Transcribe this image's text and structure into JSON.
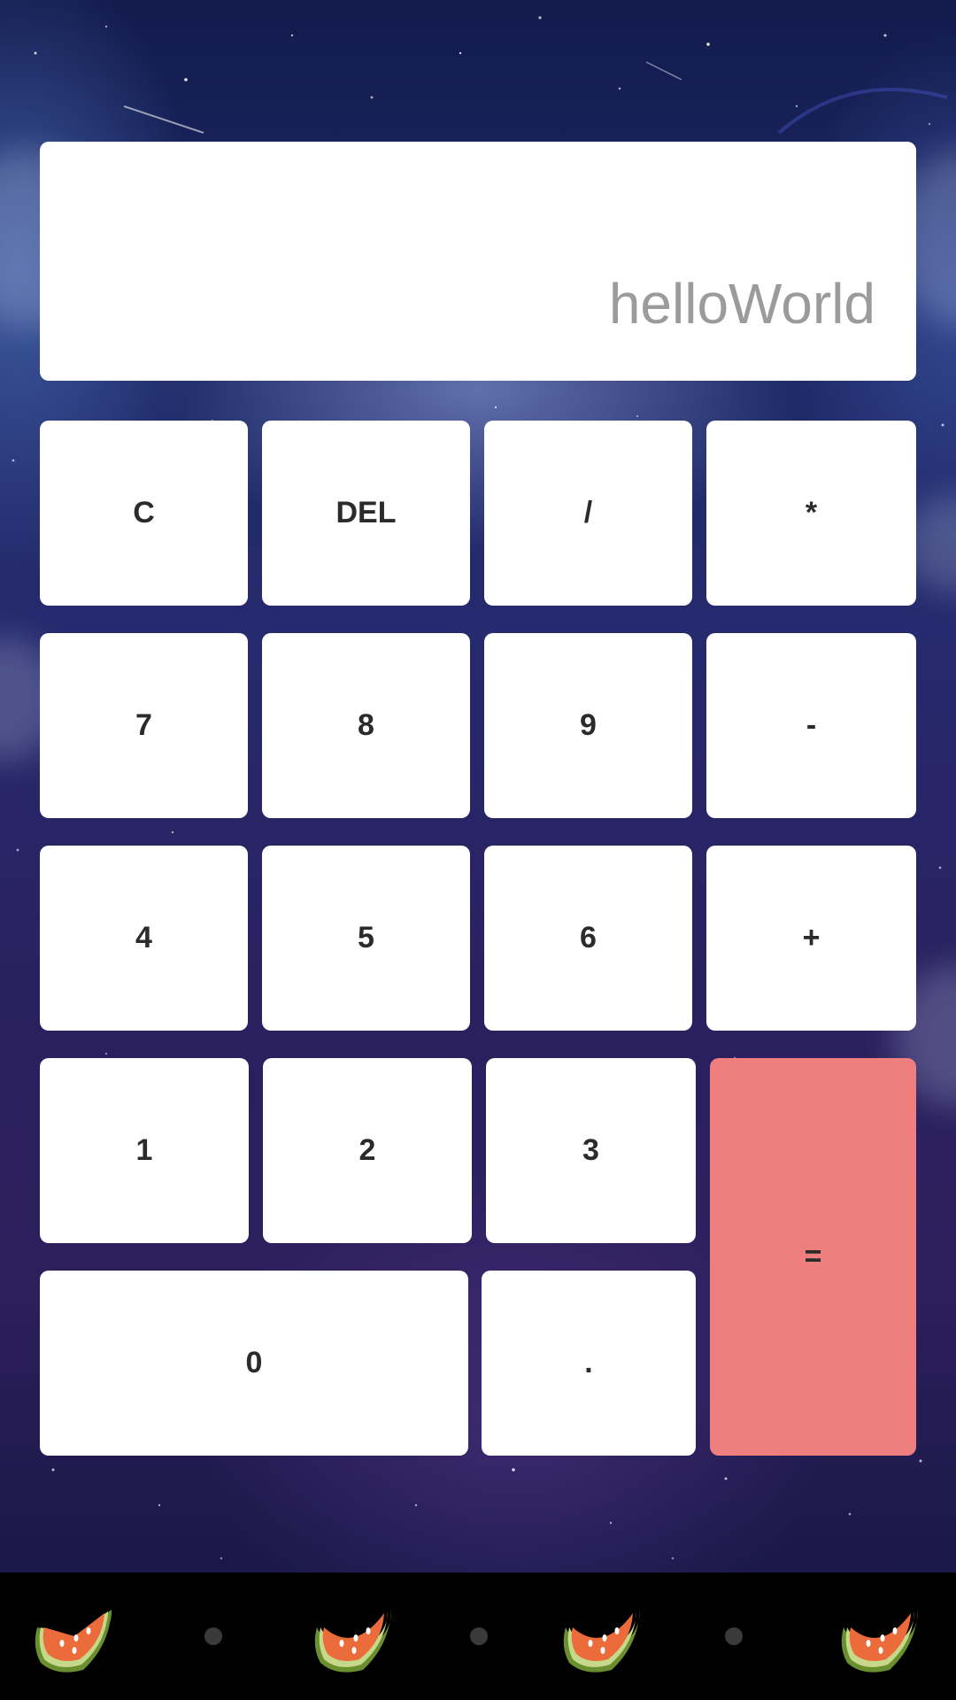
{
  "display": {
    "text": "helloWorld"
  },
  "keypad": {
    "clear": "C",
    "delete": "DEL",
    "divide": "/",
    "multiply": "*",
    "seven": "7",
    "eight": "8",
    "nine": "9",
    "minus": "-",
    "four": "4",
    "five": "5",
    "six": "6",
    "plus": "+",
    "one": "1",
    "two": "2",
    "three": "3",
    "equals": "=",
    "zero": "0",
    "dot": "."
  },
  "colors": {
    "equals_key": "#ef7f7f",
    "display_text": "#9b9b9b",
    "key_background": "#ffffff",
    "bottom_bar": "#000000"
  },
  "bottom_bar": {
    "icons": [
      "watermelon-icon",
      "watermelon-icon",
      "watermelon-icon",
      "watermelon-icon"
    ]
  }
}
